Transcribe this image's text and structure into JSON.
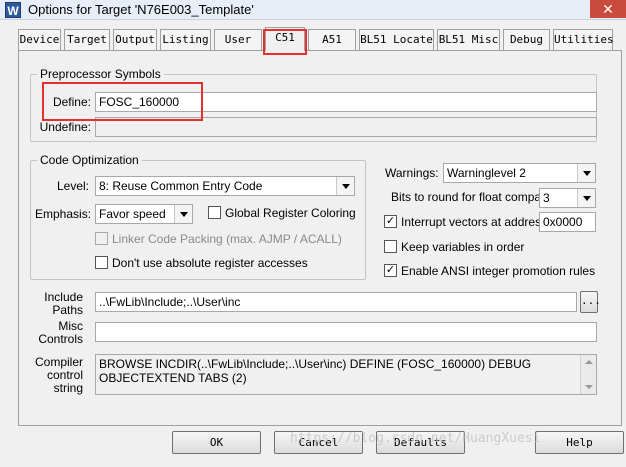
{
  "window": {
    "title": "Options for Target 'N76E003_Template'",
    "icon_letter": "W",
    "close_symbol": "✕"
  },
  "tabs": [
    {
      "label": "Device"
    },
    {
      "label": "Target"
    },
    {
      "label": "Output"
    },
    {
      "label": "Listing"
    },
    {
      "label": "User"
    },
    {
      "label": "C51",
      "active": true
    },
    {
      "label": "A51"
    },
    {
      "label": "BL51 Locate"
    },
    {
      "label": "BL51 Misc"
    },
    {
      "label": "Debug"
    },
    {
      "label": "Utilities"
    }
  ],
  "preprocessor": {
    "legend": "Preprocessor Symbols",
    "define_label": "Define:",
    "define_value": "FOSC_160000",
    "undefine_label": "Undefine:",
    "undefine_value": ""
  },
  "code_optimization": {
    "legend": "Code Optimization",
    "level_label": "Level:",
    "level_value": "8: Reuse Common Entry Code",
    "emphasis_label": "Emphasis:",
    "emphasis_value": "Favor speed",
    "global_register_coloring": {
      "label": "Global Register Coloring",
      "checked": false
    },
    "linker_code_packing": {
      "label": "Linker Code Packing (max. AJMP / ACALL)",
      "checked": false,
      "disabled": true
    },
    "no_absolute_register": {
      "label": "Don't use absolute register accesses",
      "checked": false
    }
  },
  "right_options": {
    "warnings_label": "Warnings:",
    "warnings_value": "Warninglevel 2",
    "bits_label": "Bits to round for float compare:",
    "bits_value": "3",
    "interrupt_vectors": {
      "label": "Interrupt vectors at address:",
      "checked": true,
      "value": "0x0000"
    },
    "keep_variables": {
      "label": "Keep variables in order",
      "checked": false
    },
    "ansi_promotion": {
      "label": "Enable ANSI integer promotion rules",
      "checked": true
    }
  },
  "paths": {
    "include_label_1": "Include",
    "include_label_2": "Paths",
    "include_value": "..\\FwLib\\Include;..\\User\\inc",
    "browse_label": "...",
    "misc_label_1": "Misc",
    "misc_label_2": "Controls",
    "misc_value": "",
    "compiler_label_1": "Compiler",
    "compiler_label_2": "control",
    "compiler_label_3": "string",
    "compiler_value": "BROWSE INCDIR(..\\FwLib\\Include;..\\User\\inc) DEFINE (FOSC_160000) DEBUG OBJECTEXTEND TABS (2)"
  },
  "buttons": {
    "ok": "OK",
    "cancel": "Cancel",
    "defaults": "Defaults",
    "help": "Help"
  },
  "watermark": "https://blog.csdn.net/HuangXuesi",
  "colors": {
    "highlight": "#e3312e",
    "titlebar": "#e8eef7",
    "dialog_bg": "#f0f0f0"
  }
}
